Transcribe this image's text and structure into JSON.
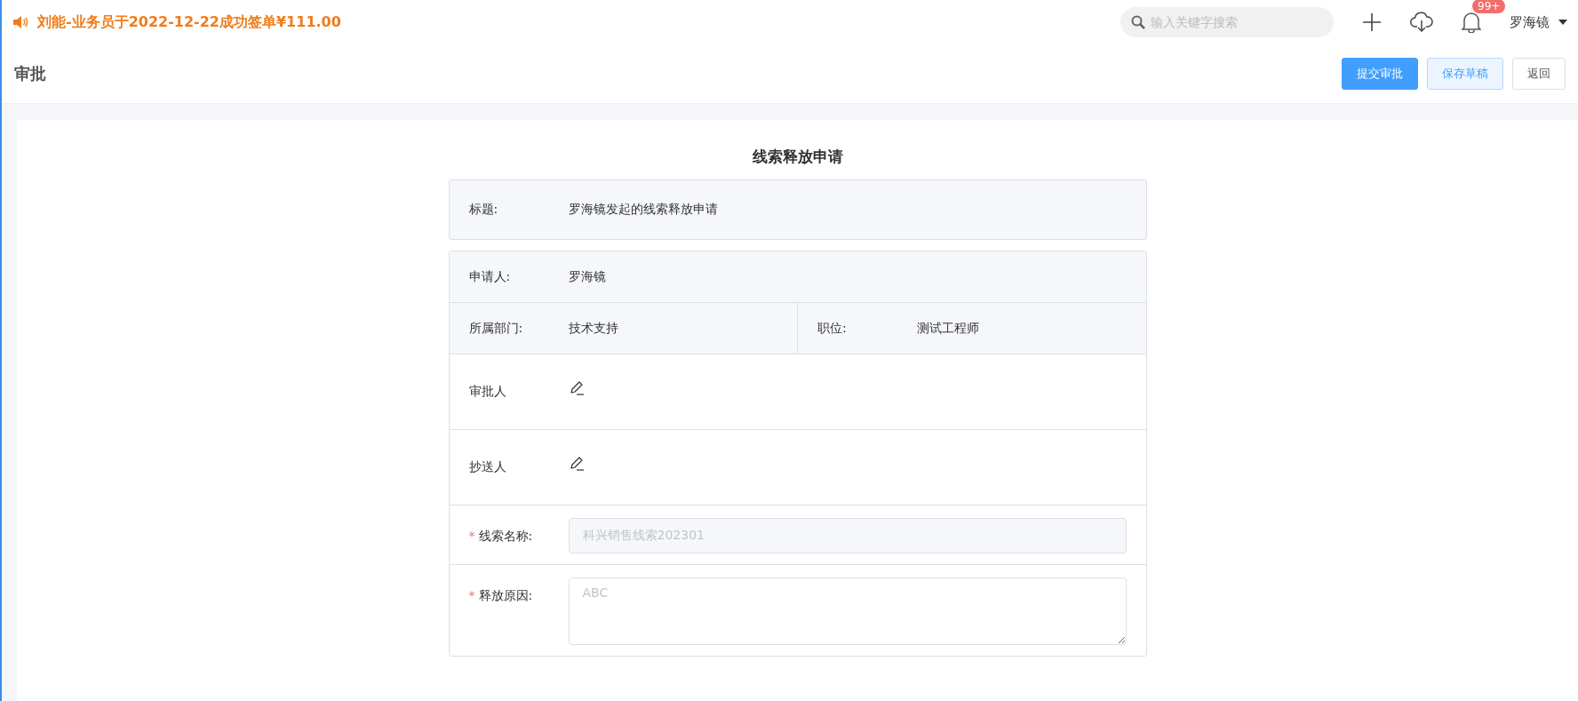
{
  "announcement": {
    "text": "刘能-业务员于2022-12-22成功签单¥111.00"
  },
  "topbar": {
    "search": {
      "placeholder": "输入关键字搜索"
    },
    "notification_badge": "99+",
    "user": "罗海镜"
  },
  "header": {
    "title": "审批",
    "buttons": [
      {
        "label": "提交审批",
        "kind": "primary"
      },
      {
        "label": "保存草稿",
        "kind": "plain"
      },
      {
        "label": "返回",
        "kind": "default"
      }
    ]
  },
  "form": {
    "title": "线索释放申请",
    "required_mark": "*",
    "title_row": {
      "label": "标题:",
      "value": "罗海镜发起的线索释放申请"
    },
    "info_rows": [
      [
        {
          "label": "申请人:",
          "value": "罗海镜"
        }
      ],
      [
        {
          "label": "所属部门:",
          "value": "技术支持"
        },
        {
          "label": "职位:",
          "value": "测试工程师"
        }
      ]
    ],
    "people_rows": [
      {
        "label": "审批人"
      },
      {
        "label": "抄送人"
      }
    ],
    "fields": [
      {
        "kind": "input",
        "label": "线索名称:",
        "required": true,
        "disabled": true,
        "value": "科兴销售线索202301"
      },
      {
        "kind": "textarea",
        "label": "释放原因:",
        "required": true,
        "placeholder": "ABC"
      }
    ]
  }
}
